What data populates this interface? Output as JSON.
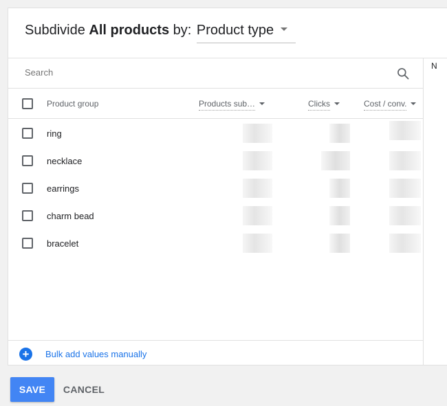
{
  "header": {
    "prefix": "Subdivide",
    "bold": "All products",
    "suffix": "by:",
    "dimension": "Product type"
  },
  "search": {
    "placeholder": "Search"
  },
  "table": {
    "columns": [
      "Product group",
      "Products sub…",
      "Clicks",
      "Cost / conv."
    ],
    "rows": [
      {
        "label": "ring"
      },
      {
        "label": "necklace"
      },
      {
        "label": "earrings"
      },
      {
        "label": "charm bead"
      },
      {
        "label": "bracelet"
      }
    ]
  },
  "footer": {
    "bulk_add_label": "Bulk add values manually",
    "add_icon_glyph": "+"
  },
  "right_panel": {
    "stub_text": "N"
  },
  "actions": {
    "save_label": "SAVE",
    "cancel_label": "CANCEL"
  },
  "colors": {
    "accent": "#4285f4",
    "link": "#1a73e8"
  }
}
